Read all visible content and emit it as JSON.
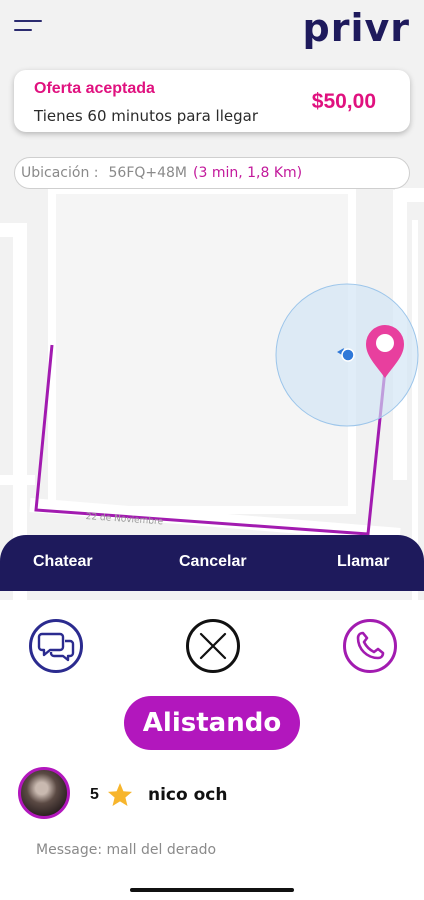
{
  "header": {
    "logo_text": "privr",
    "menu_icon": "hamburger-menu-icon"
  },
  "offer": {
    "title": "Oferta aceptada",
    "subtitle": "Tienes 60 minutos para llegar",
    "price": "$50,00"
  },
  "location": {
    "label": "Ubicación :",
    "code": "56FQ+48M",
    "eta": "(3 min, 1,8 Km)"
  },
  "map": {
    "street_label": "22 de Noviembre",
    "pin_icon": "map-pin-icon",
    "user_location_icon": "user-location-dot-icon"
  },
  "actions": {
    "chat_label": "Chatear",
    "cancel_label": "Cancelar",
    "call_label": "Llamar"
  },
  "status": {
    "label": "Alistando"
  },
  "user": {
    "rating": "5",
    "name": "nico och",
    "message": "Message: mall del derado"
  },
  "colors": {
    "brand_navy": "#1e1a5c",
    "accent_pink": "#e0117f",
    "accent_purple": "#b217bd",
    "route_purple": "#a21bb0",
    "star_yellow": "#f7b52c"
  }
}
